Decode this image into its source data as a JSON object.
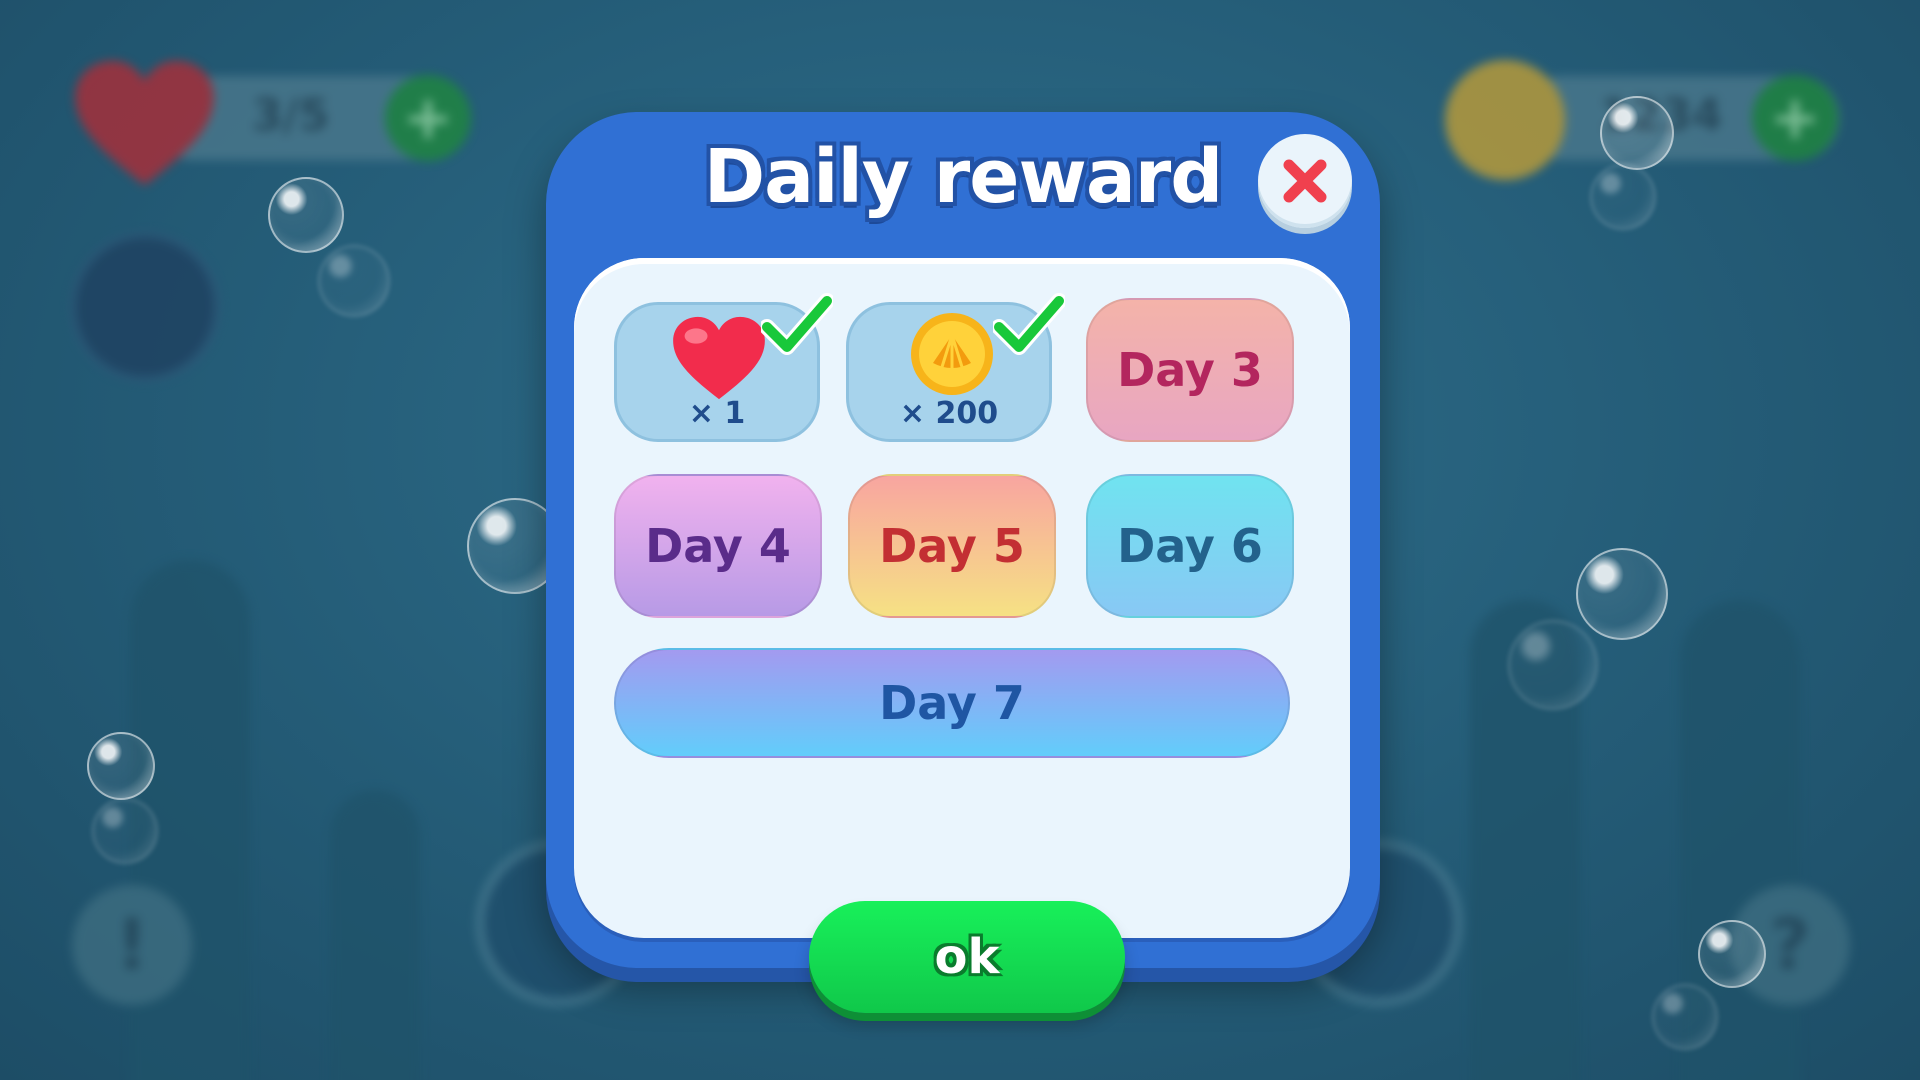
{
  "hud": {
    "lives": "3/5",
    "coins": "1234",
    "plus_left": "+",
    "plus_right": "+"
  },
  "bottom_buttons": {
    "info_symbol": "!",
    "help_symbol": "?"
  },
  "dialog": {
    "title": "Daily reward",
    "close_symbol": "✕",
    "rewards": [
      {
        "day": 1,
        "claimed": true,
        "icon": "heart-icon",
        "quantity": "× 1"
      },
      {
        "day": 2,
        "claimed": true,
        "icon": "shell-coin-icon",
        "quantity": "× 200"
      },
      {
        "day": 3,
        "claimed": false,
        "label": "Day 3"
      },
      {
        "day": 4,
        "claimed": false,
        "label": "Day 4"
      },
      {
        "day": 5,
        "claimed": false,
        "label": "Day 5"
      },
      {
        "day": 6,
        "claimed": false,
        "label": "Day 6"
      },
      {
        "day": 7,
        "claimed": false,
        "label": "Day 7"
      }
    ],
    "ok_label": "ok"
  },
  "colors": {
    "dialog_blue": "#3070d4",
    "panel": "#eaf5fd",
    "ok_green": "#10c84a",
    "check_green": "#19c83a",
    "close_red": "#f0404e"
  }
}
